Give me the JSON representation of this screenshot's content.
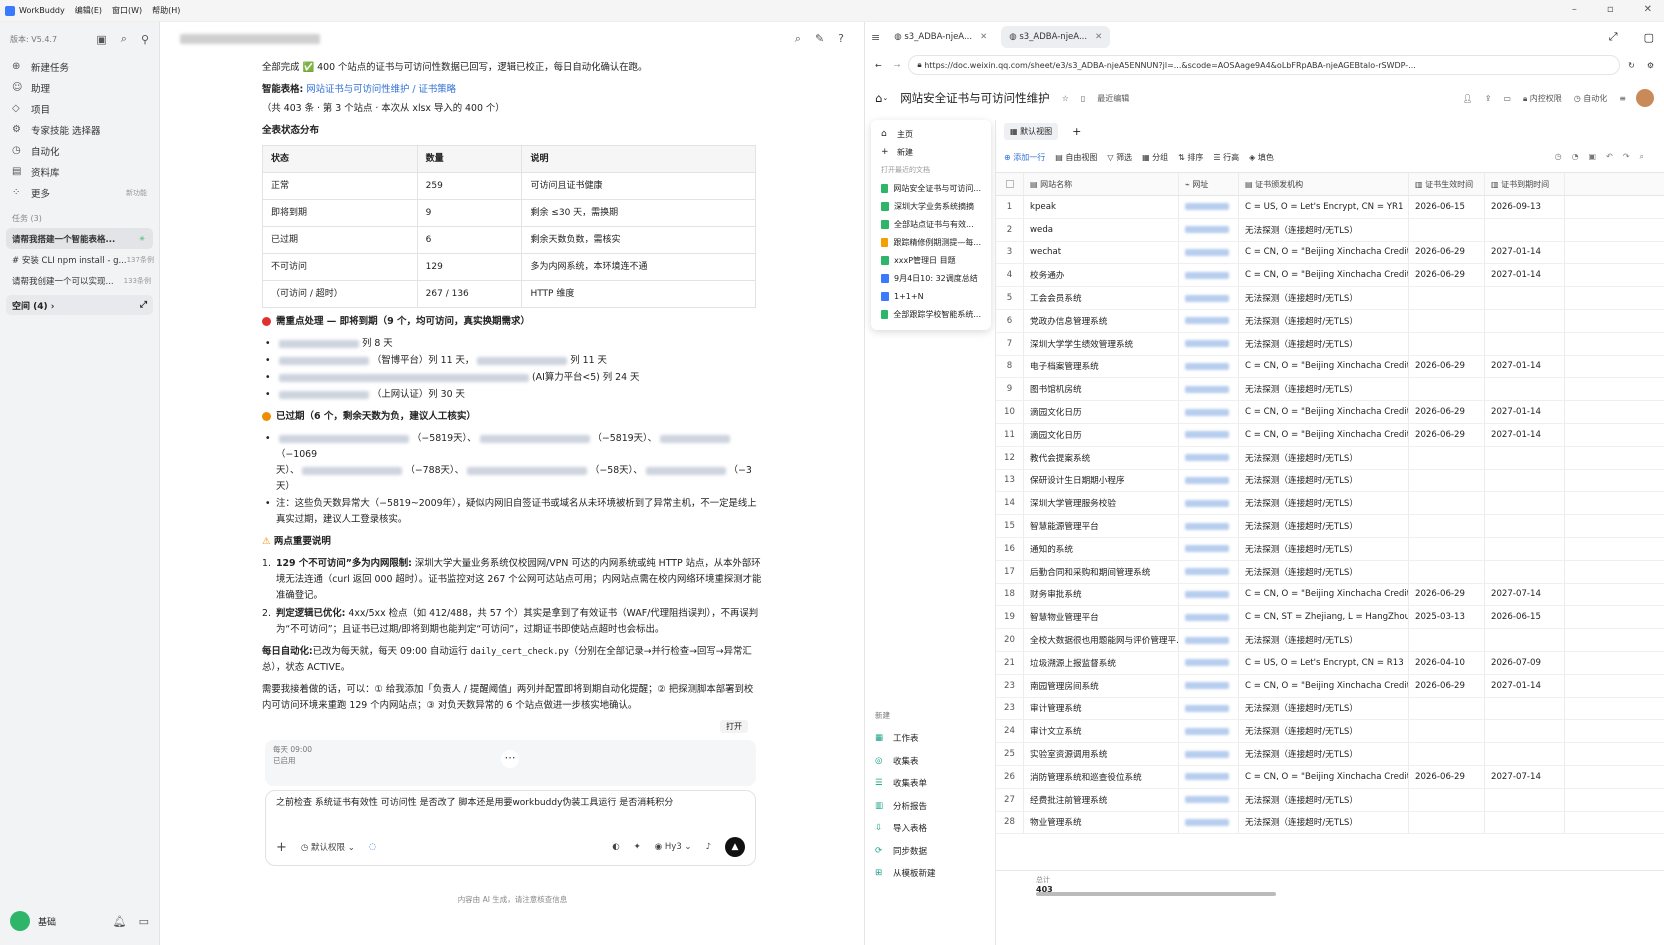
{
  "menubar": {
    "app": "WorkBuddy",
    "items": [
      "编辑(E)",
      "窗口(W)",
      "帮助(H)"
    ]
  },
  "sidebar": {
    "version": "版本: V5.4.7",
    "nav": [
      {
        "icon": "plus-circle-icon",
        "label": "新建任务"
      },
      {
        "icon": "assistant-icon",
        "label": "助理"
      },
      {
        "icon": "project-icon",
        "label": "项目"
      },
      {
        "icon": "expert-icon",
        "label": "专家技能 选择器"
      },
      {
        "icon": "automation-icon",
        "label": "自动化"
      },
      {
        "icon": "library-icon",
        "label": "资料库"
      },
      {
        "icon": "more-icon",
        "label": "更多",
        "tag": "新功能"
      }
    ],
    "tasks_header": "任务 (3)",
    "tasks": [
      {
        "label": "请帮我搭建一个智能表格...",
        "active": true,
        "count": ""
      },
      {
        "label": "# 安装 CLI npm install - g...",
        "count": "137条例"
      },
      {
        "label": "请帮我创建一个可以实现...",
        "count": "133条例"
      }
    ],
    "space": "空间 (4) ›",
    "bottom_label": "基础"
  },
  "chat": {
    "line1": "全部完成 ✅ 400 个站点的证书与可访问性数据已回写，逻辑已校正，每日自动化确认在跑。",
    "smart_label": "智能表格:",
    "smart_link": "网站证书与可访问性维护 / 证书策略",
    "smart_sub": "（共 403 条 · 第 3 个站点 · 本次从 xlsx 导入的 400 个）",
    "dist_title": "全表状态分布",
    "table_head": [
      "状态",
      "数量",
      "说明"
    ],
    "table_rows": [
      [
        "正常",
        "259",
        "可访问且证书健康"
      ],
      [
        "即将到期",
        "9",
        "剩余 ≤30 天，需换期"
      ],
      [
        "已过期",
        "6",
        "剩余天数负数，需核实"
      ],
      [
        "不可访问",
        "129",
        "多为内网系统，本环境连不通"
      ],
      [
        "（可访问 / 超时）",
        "267 / 136",
        "HTTP 维度"
      ]
    ],
    "expiring_title": "需重点处理 — 即将到期（9 个，均可访问，真实换期需求）",
    "expiring_items": [
      "列 8 天",
      "（智博平台）列 11 天，",
      "列 11 天",
      "(AI算力平台<5) 列 24 天",
      "（上网认证）列 30 天"
    ],
    "expired_title": "已过期（6 个，剩余天数为负，建议人工核实）",
    "expired_l1a": "（−5819天）、",
    "expired_l1b": "（−5819天）、",
    "expired_l1c": "（−1069",
    "expired_l2a": "天）、",
    "expired_l2b": "（−788天）、",
    "expired_l2c": "（−58天）、",
    "expired_l2d": "（−3",
    "expired_l3": "天）",
    "note": "注：这些负天数异常大（−5819~2009年），疑似内网旧自签证书或域名从未环境被析到了异常主机，不一定是线上真实过期，建议人工登录核实。",
    "two_title": "两点重要说明",
    "p1_bold": "129 个不可访问”多为内网限制:",
    "p1": "深圳大学大量业务系统仅校园网/VPN 可达的内网系统或纯 HTTP 站点，从本外部环境无法连通（curl 返回 000 超时）。证书监控对这 267 个公网可达站点可用；内网站点需在校内网络环境重探测才能准确登记。",
    "p2_bold": "判定逻辑已优化:",
    "p2": "4xx/5xx 检点（如 412/488，共 57 个）其实是拿到了有效证书（WAF/代理阻挡误判），不再误判为“不可访问”；且证书已过期/即将到期也能判定“可访问”，过期证书即使站点超时也会标出。",
    "daily_bold": "每日自动化:",
    "daily_a": "已改为每天就，每天 09:00 自动运行 ",
    "daily_code": "daily_cert_check.py",
    "daily_b": "（分别在全部记录→并行检查→回写→异常汇总），状态 ACTIVE。",
    "followup": "需要我接着做的话，可以：① 给我添加「负责人 / 提醒阈值」两列并配置即将到期自动化提醒；② 把探测脚本部署到校内可访问环境来重跑 129 个内网站点；③ 对负天数异常的 6 个站点做进一步核实地确认。",
    "open_btn": "打开",
    "sched_time": "每天 09:00",
    "sched_state": "已启用",
    "compose_text": "之前检查 系统证书有效性 可访问性 是否改了 脚本还是用要workbuddy伪装工具运行 是否消耗积分",
    "perm": "默认权限",
    "model": "Hy3",
    "footer": "内容由 AI 生成，请注意核查信息"
  },
  "browser": {
    "tabs": [
      "s3_ADBA-njeA...",
      "s3_ADBA-njeA..."
    ],
    "url": "https://doc.weixin.qq.com/sheet/e3/s3_ADBA-njeA5ENNUN?jl=...&scode=AOSAage9A4&oLbFRpABA-njeAGEBtalo-rSWDP-...",
    "doc_title": "网站安全证书与可访问性维护",
    "doc_sub": "最近编辑",
    "perm": "内控权限",
    "auto": "自动化"
  },
  "leftnav": {
    "home": "主页",
    "new": "新建",
    "recent": "打开最近的文档",
    "docs": [
      "网站安全证书与可访问...",
      "深圳大学业务系统摘摘",
      "全部站点证书与有效...",
      "跟踪精修例期测提—每...",
      "xxxP管理日 目题",
      "9月4日10: 32调度总结",
      "1+1+N",
      "全部跟踪学校智能系统..."
    ],
    "new_sec": "新建",
    "new_items": [
      "工作表",
      "收集表",
      "收集表单",
      "分析报告",
      "导入表格",
      "同步数据",
      "从模板新建"
    ]
  },
  "grid": {
    "view": "默认视图",
    "toolbar": [
      "添加一行",
      "自由视图",
      "筛选",
      "分组",
      "排序",
      "行高",
      "填色"
    ],
    "headers": [
      "网站名称",
      "网址",
      "证书颁发机构",
      "证书生效时间",
      "证书到期时间"
    ],
    "rows": [
      [
        "1",
        "kpeak",
        "C = US, O = Let's Encrypt, CN = YR1",
        "2026-06-15",
        "2026-09-13"
      ],
      [
        "2",
        "weda",
        "无法探测（连接超时/无TLS）",
        "",
        ""
      ],
      [
        "3",
        "wechat",
        "C = CN, O = \"Beijing Xinchacha Credit ...",
        "2026-06-29",
        "2027-01-14"
      ],
      [
        "4",
        "校务通办",
        "C = CN, O = \"Beijing Xinchacha Credit ...",
        "2026-06-29",
        "2027-01-14"
      ],
      [
        "5",
        "工会会员系统",
        "无法探测（连接超时/无TLS）",
        "",
        ""
      ],
      [
        "6",
        "党政办信息管理系统",
        "无法探测（连接超时/无TLS）",
        "",
        ""
      ],
      [
        "7",
        "深圳大学学生绩效管理系统",
        "无法探测（连接超时/无TLS）",
        "",
        ""
      ],
      [
        "8",
        "电子档案管理系统",
        "C = CN, O = \"Beijing Xinchacha Credit ...",
        "2026-06-29",
        "2027-01-14"
      ],
      [
        "9",
        "图书馆机房统",
        "无法探测（连接超时/无TLS）",
        "",
        ""
      ],
      [
        "10",
        "滴园文化日历",
        "C = CN, O = \"Beijing Xinchacha Credit ...",
        "2026-06-29",
        "2027-01-14"
      ],
      [
        "11",
        "滴园文化日历",
        "C = CN, O = \"Beijing Xinchacha Credit ...",
        "2026-06-29",
        "2027-01-14"
      ],
      [
        "12",
        "教代会提案系统",
        "无法探测（连接超时/无TLS）",
        "",
        ""
      ],
      [
        "13",
        "保研设计生日期期小程序",
        "无法探测（连接超时/无TLS）",
        "",
        ""
      ],
      [
        "14",
        "深圳大学管理服务校验",
        "无法探测（连接超时/无TLS）",
        "",
        ""
      ],
      [
        "15",
        "智慧能源管理平台",
        "无法探测（连接超时/无TLS）",
        "",
        ""
      ],
      [
        "16",
        "通知的系统",
        "无法探测（连接超时/无TLS）",
        "",
        ""
      ],
      [
        "17",
        "后勤合同和采购和期间管理系统",
        "无法探测（连接超时/无TLS）",
        "",
        ""
      ],
      [
        "18",
        "财务审批系统",
        "C = CN, O = \"Beijing Xinchacha Credit ...",
        "2026-06-29",
        "2027-07-14"
      ],
      [
        "19",
        "智慧物业管理平台",
        "C = CN, ST = Zhejiang, L = HangZhou, ...",
        "2025-03-13",
        "2026-06-15"
      ],
      [
        "20",
        "全校大数据很也用题能网与评价管理平...",
        "无法探测（连接超时/无TLS）",
        "",
        ""
      ],
      [
        "21",
        "垃圾溯源上报监督系统",
        "C = US, O = Let's Encrypt, CN = R13",
        "2026-04-10",
        "2026-07-09"
      ],
      [
        "23",
        "南园管理房间系统",
        "C = CN, O = \"Beijing Xinchacha Credit ...",
        "2026-06-29",
        "2027-01-14"
      ],
      [
        "23",
        "审计管理系统",
        "无法探测（连接超时/无TLS）",
        "",
        ""
      ],
      [
        "24",
        "审计文立系统",
        "无法探测（连接超时/无TLS）",
        "",
        ""
      ],
      [
        "25",
        "实验室资源调用系统",
        "无法探测（连接超时/无TLS）",
        "",
        ""
      ],
      [
        "26",
        "消防管理系统和巡查役位系统",
        "C = CN, O = \"Beijing Xinchacha Credit ...",
        "2026-06-29",
        "2027-07-14"
      ],
      [
        "27",
        "经费批注前管理系统",
        "无法探测（连接超时/无TLS）",
        "",
        ""
      ],
      [
        "28",
        "物业管理系统",
        "无法探测（连接超时/无TLS）",
        "",
        ""
      ]
    ],
    "total_label": "总计",
    "total_value": "403"
  }
}
